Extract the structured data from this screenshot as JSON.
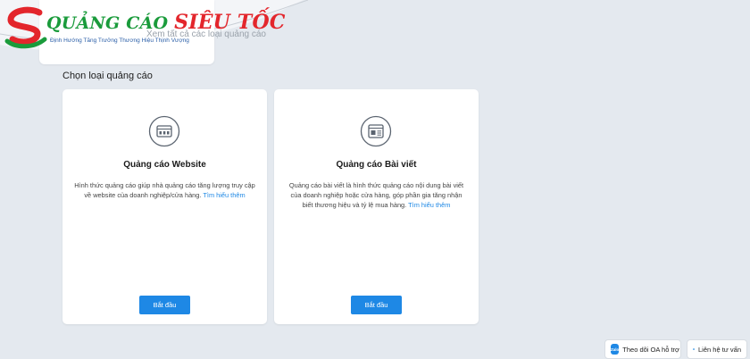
{
  "branding": {
    "logo_main": "QUẢNG CÁO",
    "logo_accent": "SIÊU TỐC",
    "logo_slogan": "Định Hướng Tăng Trưởng Thương Hiệu Thịnh Vượng"
  },
  "top_card": {
    "text": "Xem tất cả các loại quảng cáo"
  },
  "section": {
    "title": "Chọn loại quảng cáo"
  },
  "cards": {
    "website": {
      "icon": "website-icon",
      "title": "Quảng cáo Website",
      "description": "Hình thức quảng cáo giúp nhà quảng cáo tăng lượng truy cập về website của doanh nghiệp/cửa hàng.",
      "link": "Tìm hiểu thêm",
      "button": "Bắt đầu"
    },
    "post": {
      "icon": "article-icon",
      "title": "Quảng cáo Bài viết",
      "description": "Quảng cáo bài viết là hình thức quảng cáo nội dung bài viết của doanh nghiệp hoặc cửa hàng, góp phần gia tăng nhận biết thương hiệu và tỷ lệ mua hàng.",
      "link": "Tìm hiểu thêm",
      "button": "Bắt đầu"
    }
  },
  "floating": {
    "zalo_badge": "Zalo",
    "zalo_label": "Theo dõi OA hỗ trợ",
    "contact_label": "Liên hệ tư vấn"
  },
  "colors": {
    "accent": "#1e88e5",
    "logo_green": "#1a9b3b",
    "logo_red": "#e3262c",
    "background": "#e4e9ef"
  }
}
